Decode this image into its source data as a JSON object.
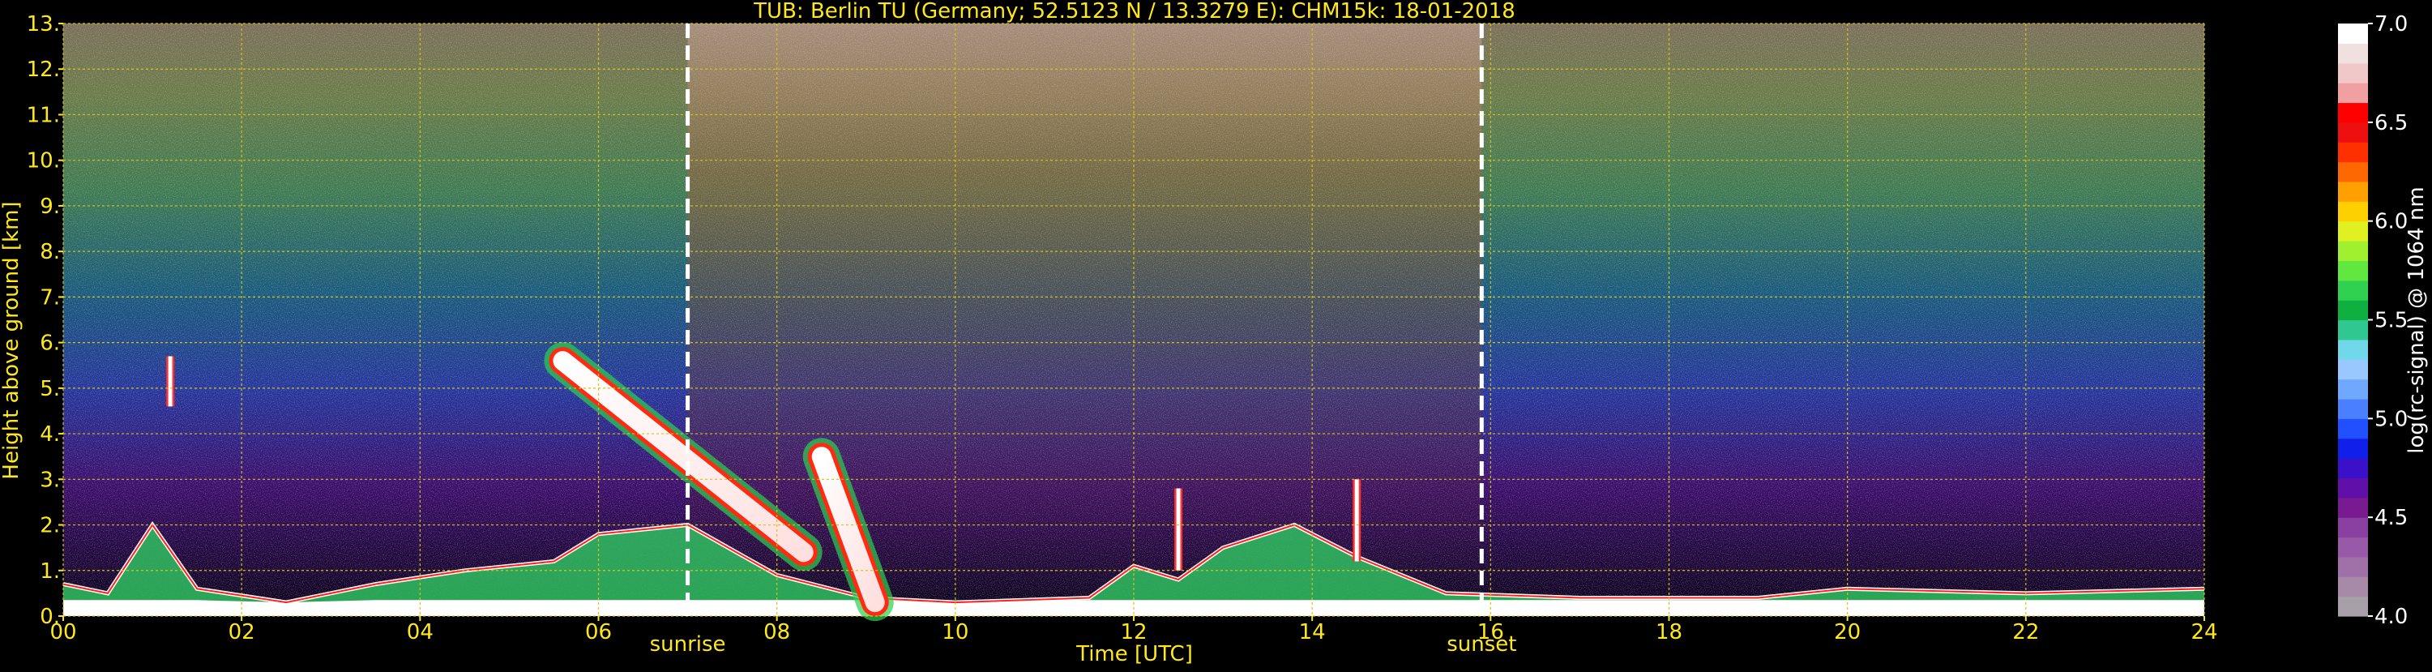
{
  "chart_data": {
    "type": "heatmap",
    "title": "TUB: Berlin TU (Germany; 52.5123 N / 13.3279 E):    CHM15k: 18-01-2018",
    "xlabel": "Time [UTC]",
    "ylabel": "Height above ground [km]",
    "xlim": [
      0,
      24
    ],
    "ylim": [
      0,
      13
    ],
    "x_ticks": [
      0,
      2,
      4,
      6,
      8,
      10,
      12,
      14,
      16,
      18,
      20,
      22,
      24
    ],
    "x_tick_labels": [
      "00",
      "02",
      "04",
      "06",
      "08",
      "10",
      "12",
      "14",
      "16",
      "18",
      "20",
      "22",
      "24"
    ],
    "y_ticks": [
      0,
      1,
      2,
      3,
      4,
      5,
      6,
      7,
      8,
      9,
      10,
      11,
      12,
      13
    ],
    "y_tick_labels": [
      "0.",
      "1.",
      "2.",
      "3.",
      "4.",
      "5.",
      "6.",
      "7.",
      "8.",
      "9.",
      "10.",
      "11.",
      "12.",
      "13."
    ],
    "grid": true,
    "grid_color": "#d4c419",
    "text_color": "#ffe81a",
    "colorbar": {
      "label": "log(rc-signal) @ 1064 nm",
      "range": [
        4.0,
        7.0
      ],
      "tick_values": [
        4.0,
        4.5,
        5.0,
        5.5,
        6.0,
        6.5,
        7.0
      ],
      "tick_labels": [
        "4.0",
        "4.5",
        "5.0",
        "5.5",
        "6.0",
        "6.5",
        "7.0"
      ],
      "colors": [
        "#a8a0a8",
        "#a88aa8",
        "#a070a8",
        "#985aa8",
        "#8a40a0",
        "#7a1a90",
        "#6010a8",
        "#3a10c8",
        "#1020e8",
        "#2050ff",
        "#4a80ff",
        "#70a8ff",
        "#98c8ff",
        "#70d8e8",
        "#30c890",
        "#10b040",
        "#30d050",
        "#60e840",
        "#a0f030",
        "#e0f020",
        "#ffd000",
        "#ffa000",
        "#ff6800",
        "#ff3000",
        "#ee1010",
        "#ff0000",
        "#f0a0a0",
        "#f0c8c8",
        "#f0e0e0",
        "#ffffff"
      ]
    },
    "annotations": [
      {
        "label": "sunrise",
        "x": 7.0
      },
      {
        "label": "sunset",
        "x": 15.9
      }
    ],
    "regions": [
      {
        "kind": "boundary_layer",
        "top_km": [
          [
            0,
            0.7
          ],
          [
            0.5,
            0.5
          ],
          [
            1.0,
            2.0
          ],
          [
            1.5,
            0.6
          ],
          [
            2.5,
            0.3
          ],
          [
            3.5,
            0.7
          ],
          [
            4.5,
            1.0
          ],
          [
            5.5,
            1.2
          ],
          [
            6.0,
            1.8
          ],
          [
            7.0,
            2.0
          ],
          [
            8.0,
            0.9
          ],
          [
            9.0,
            0.4
          ],
          [
            10.0,
            0.3
          ],
          [
            11.5,
            0.4
          ],
          [
            12.0,
            1.1
          ],
          [
            12.5,
            0.8
          ],
          [
            13.0,
            1.5
          ],
          [
            13.8,
            2.0
          ],
          [
            14.5,
            1.3
          ],
          [
            15.5,
            0.5
          ],
          [
            17.0,
            0.4
          ],
          [
            19.0,
            0.4
          ],
          [
            20.0,
            0.6
          ],
          [
            22.0,
            0.5
          ],
          [
            24.0,
            0.6
          ]
        ]
      },
      {
        "kind": "elevated_aerosol_layer",
        "from": [
          5.6,
          5.6
        ],
        "to": [
          8.3,
          1.4
        ]
      },
      {
        "kind": "elevated_aerosol_layer",
        "from": [
          8.5,
          3.5
        ],
        "to": [
          9.1,
          0.3
        ]
      },
      {
        "kind": "cloud_streak",
        "x": 1.2,
        "bottom_km": 4.6,
        "top_km": 5.7
      },
      {
        "kind": "cloud_streak",
        "x": 14.5,
        "bottom_km": 1.2,
        "top_km": 3.0
      },
      {
        "kind": "cloud_streak",
        "x": 12.5,
        "bottom_km": 1.0,
        "top_km": 2.8
      }
    ]
  }
}
